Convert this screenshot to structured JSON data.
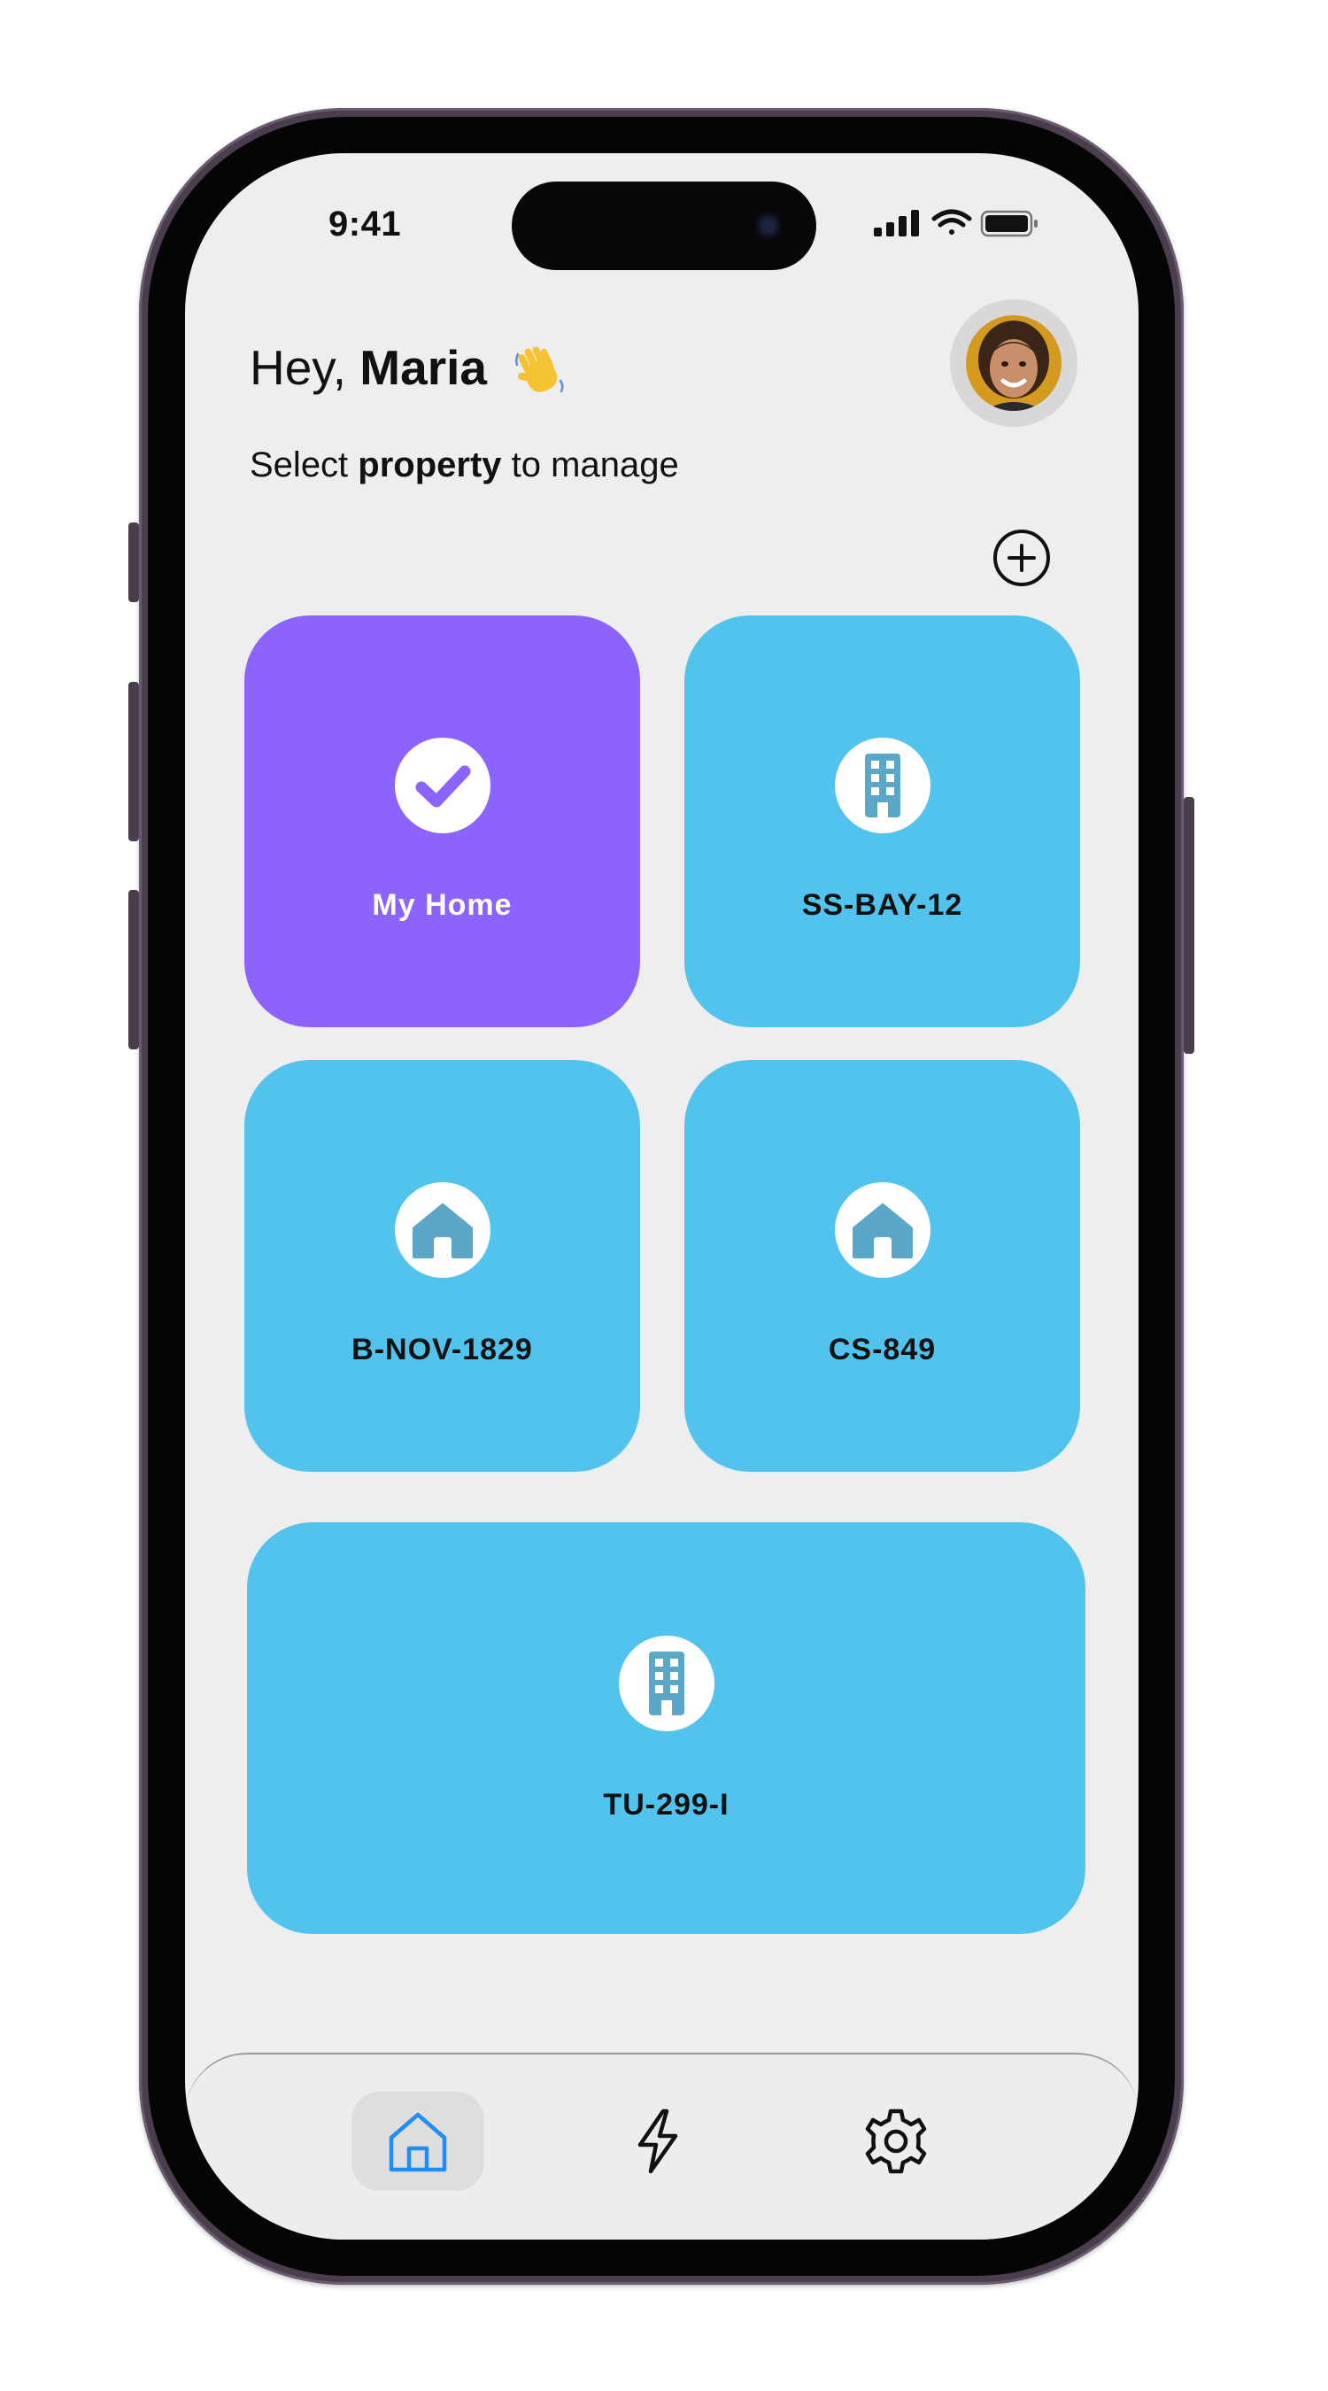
{
  "status_bar": {
    "time": "9:41",
    "icons": [
      "cellular-signal-icon",
      "wifi-icon",
      "battery-icon"
    ]
  },
  "header": {
    "greeting_prefix": "Hey, ",
    "user_name": "Maria",
    "greeting_emoji": "waving-hand-icon",
    "subtitle_prefix": "Select ",
    "subtitle_bold": "property",
    "subtitle_suffix": " to manage",
    "add_icon": "plus-circle-icon"
  },
  "properties": [
    {
      "label": "My Home",
      "icon": "check-icon",
      "selected": true
    },
    {
      "label": "SS-BAY-12",
      "icon": "building-icon",
      "selected": false
    },
    {
      "label": "B-NOV-1829",
      "icon": "house-icon",
      "selected": false
    },
    {
      "label": "CS-849",
      "icon": "house-icon",
      "selected": false
    },
    {
      "label": "TU-299-I",
      "icon": "building-icon",
      "selected": false
    }
  ],
  "bottom_nav": [
    {
      "name": "home",
      "icon": "home-icon",
      "active": true
    },
    {
      "name": "energy",
      "icon": "lightning-icon",
      "active": false
    },
    {
      "name": "settings",
      "icon": "gear-icon",
      "active": false
    }
  ],
  "colors": {
    "background": "#eeeeee",
    "selected_card": "#8c63fd",
    "card": "#52c3ec",
    "card_icon_glyph": "#5aa7c8",
    "nav_active": "#1f8ef0"
  }
}
